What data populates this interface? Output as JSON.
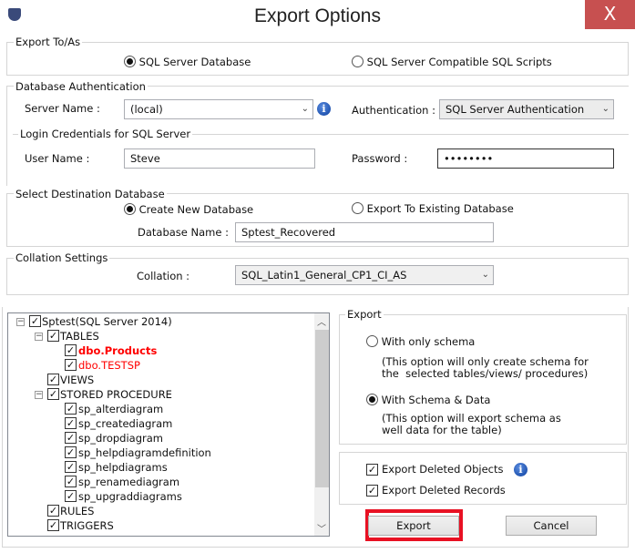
{
  "window": {
    "title": "Export Options",
    "close_label": "X"
  },
  "export_to": {
    "legend": "Export To/As",
    "options": [
      {
        "label": "SQL Server Database",
        "selected": true
      },
      {
        "label": "SQL Server Compatible SQL Scripts",
        "selected": false
      }
    ]
  },
  "auth": {
    "legend": "Database Authentication",
    "server_label": "Server Name :",
    "server_value": "(local)",
    "auth_label": "Authentication :",
    "auth_value": "SQL Server Authentication",
    "login_legend": "Login Credentials for SQL Server",
    "user_label": "User Name :",
    "user_value": "Steve",
    "password_label": "Password :",
    "password_value": "••••••••"
  },
  "destination": {
    "legend": "Select Destination Database",
    "options": [
      {
        "label": "Create New Database",
        "selected": true
      },
      {
        "label": "Export To Existing Database",
        "selected": false
      }
    ],
    "dbname_label": "Database Name :",
    "dbname_value": "Sptest_Recovered"
  },
  "collation": {
    "legend": "Collation Settings",
    "label": "Collation :",
    "value": "SQL_Latin1_General_CP1_CI_AS"
  },
  "tree": [
    {
      "label": "Sptest(SQL Server 2014)",
      "level": 0,
      "expand": true,
      "checked": true
    },
    {
      "label": "TABLES",
      "level": 1,
      "expand": true,
      "checked": true
    },
    {
      "label": "dbo.Products",
      "level": 2,
      "checked": true,
      "style": "red-bold"
    },
    {
      "label": "dbo.TESTSP",
      "level": 2,
      "checked": true,
      "style": "red"
    },
    {
      "label": "VIEWS",
      "level": 1,
      "checked": true
    },
    {
      "label": "STORED PROCEDURE",
      "level": 1,
      "expand": true,
      "checked": true
    },
    {
      "label": "sp_alterdiagram",
      "level": 2,
      "checked": true
    },
    {
      "label": "sp_creatediagram",
      "level": 2,
      "checked": true
    },
    {
      "label": "sp_dropdiagram",
      "level": 2,
      "checked": true
    },
    {
      "label": "sp_helpdiagramdefinition",
      "level": 2,
      "checked": true
    },
    {
      "label": "sp_helpdiagrams",
      "level": 2,
      "checked": true
    },
    {
      "label": "sp_renamediagram",
      "level": 2,
      "checked": true
    },
    {
      "label": "sp_upgraddiagrams",
      "level": 2,
      "checked": true
    },
    {
      "label": "RULES",
      "level": 1,
      "checked": true
    },
    {
      "label": "TRIGGERS",
      "level": 1,
      "checked": true
    }
  ],
  "export": {
    "legend": "Export",
    "schema_only_label": "With only schema",
    "schema_only_desc1": "(This option will only create schema for",
    "schema_only_desc2": "the  selected tables/views/ procedures)",
    "schema_data_label": "With Schema & Data",
    "schema_data_desc1": "(This option will export schema as",
    "schema_data_desc2": "well data for the table)",
    "selected": "schema_data"
  },
  "options": {
    "deleted_objects_label": "Export Deleted Objects",
    "deleted_objects_checked": true,
    "deleted_records_label": "Export Deleted Records",
    "deleted_records_checked": true
  },
  "buttons": {
    "export": "Export",
    "cancel": "Cancel"
  },
  "colors": {
    "highlight": "#e81123",
    "close": "#c75050",
    "red_text": "#ff0000"
  }
}
